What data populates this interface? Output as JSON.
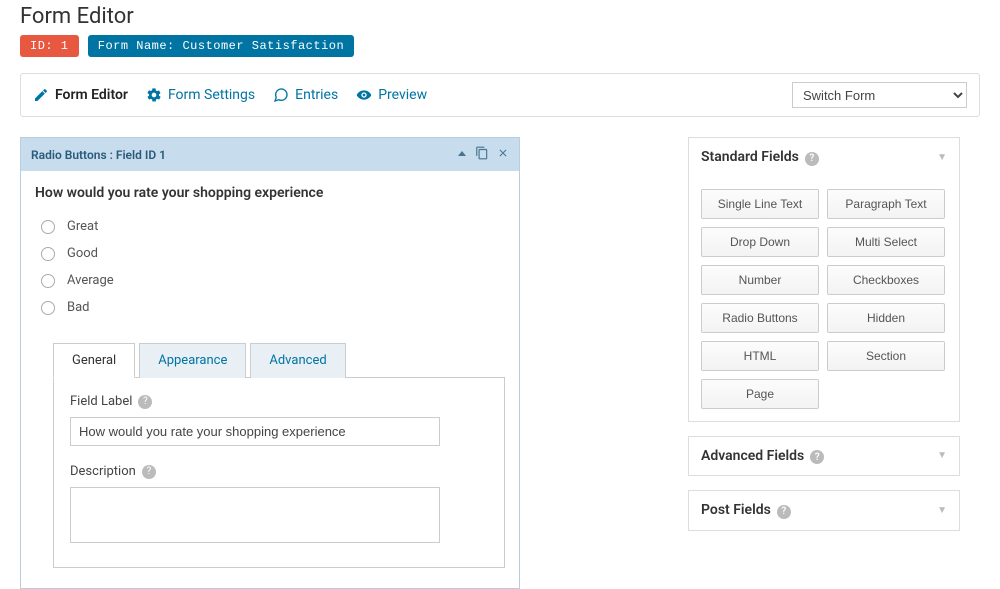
{
  "page": {
    "title": "Form Editor"
  },
  "badges": {
    "id_label": "ID: 1",
    "name_label": "Form Name: Customer Satisfaction"
  },
  "toolbar": {
    "editor": "Form Editor",
    "settings": "Form Settings",
    "entries": "Entries",
    "preview": "Preview",
    "switch_placeholder": "Switch Form"
  },
  "field": {
    "header": "Radio Buttons : Field ID 1",
    "question": "How would you rate your shopping experience",
    "options": [
      "Great",
      "Good",
      "Average",
      "Bad"
    ]
  },
  "tabs": {
    "general": "General",
    "appearance": "Appearance",
    "advanced": "Advanced"
  },
  "settings": {
    "field_label_label": "Field Label",
    "field_label_value": "How would you rate your shopping experience",
    "description_label": "Description",
    "description_value": ""
  },
  "panels": {
    "standard": {
      "title": "Standard Fields",
      "buttons": [
        "Single Line Text",
        "Paragraph Text",
        "Drop Down",
        "Multi Select",
        "Number",
        "Checkboxes",
        "Radio Buttons",
        "Hidden",
        "HTML",
        "Section",
        "Page"
      ]
    },
    "advanced": {
      "title": "Advanced Fields"
    },
    "post": {
      "title": "Post Fields"
    }
  }
}
